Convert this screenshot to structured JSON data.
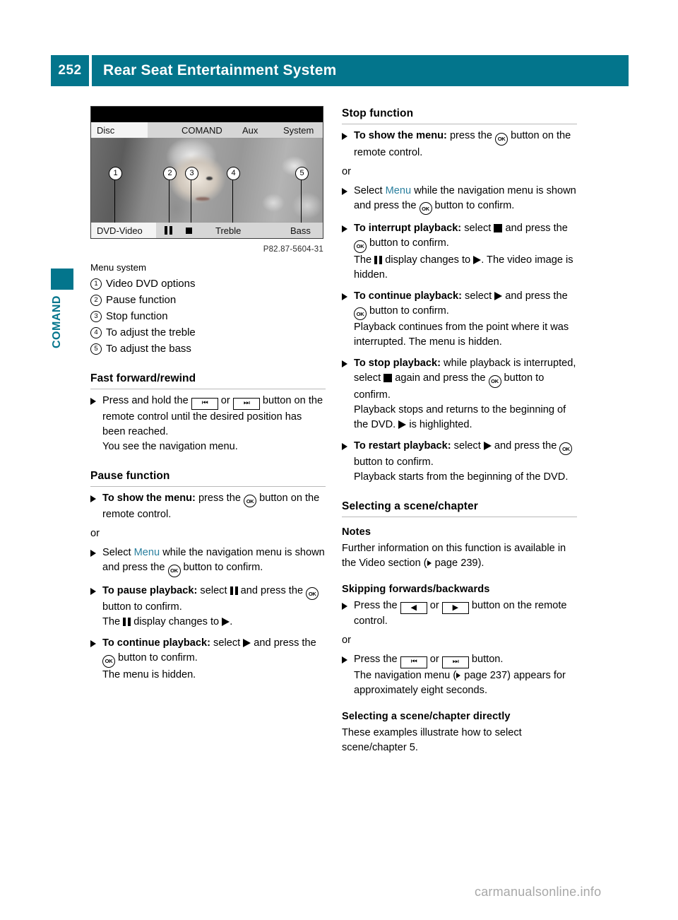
{
  "header": {
    "page_number": "252",
    "title": "Rear Seat Entertainment System"
  },
  "side_tab": {
    "label": "COMAND",
    "accent_color": "#03758c"
  },
  "figure": {
    "screen": {
      "top_tabs": [
        "Disc",
        "COMAND",
        "Aux",
        "System"
      ],
      "selected_top_tab": "Disc",
      "bottom_items": [
        "DVD-Video",
        "pause-glyph",
        "stop-glyph",
        "Treble",
        "Bass"
      ],
      "bottom_labels": {
        "source": "DVD-Video",
        "treble": "Treble",
        "bass": "Bass"
      },
      "callouts": [
        "1",
        "2",
        "3",
        "4",
        "5"
      ]
    },
    "caption": "P82.87-5604-31"
  },
  "legend": {
    "title": "Menu system",
    "items": [
      {
        "num": "1",
        "text": "Video DVD options"
      },
      {
        "num": "2",
        "text": "Pause function"
      },
      {
        "num": "3",
        "text": "Stop function"
      },
      {
        "num": "4",
        "text": "To adjust the treble"
      },
      {
        "num": "5",
        "text": "To adjust the bass"
      }
    ]
  },
  "left_column": {
    "fast_forward": {
      "heading": "Fast forward/rewind",
      "step1_a": "Press and hold the ",
      "step1_key1": "⏮",
      "step1_or": " or ",
      "step1_key2": "⏭",
      "step1_b": " button on the remote control until the desired position has been reached.",
      "step1_c": "You see the navigation menu."
    },
    "pause_function": {
      "heading": "Pause function",
      "s1_bold": "To show the menu:",
      "s1_a": " press the ",
      "s1_ok": "OK",
      "s1_b": " button on the remote control.",
      "or": "or",
      "s2_a": "Select ",
      "s2_menu": "Menu",
      "s2_b": " while the navigation menu is shown and press the ",
      "s2_ok": "OK",
      "s2_c": " button to confirm.",
      "s3_bold": "To pause playback:",
      "s3_a": " select ",
      "s3_b": " and press the ",
      "s3_ok": "OK",
      "s3_c": " button to confirm.",
      "s3_d1": "The ",
      "s3_d2": " display changes to ",
      "s3_d3": ".",
      "s4_bold": "To continue playback:",
      "s4_a": " select ",
      "s4_b": " and press the ",
      "s4_ok": "OK",
      "s4_c": " button to confirm.",
      "s4_d": "The menu is hidden."
    }
  },
  "right_column": {
    "stop_function": {
      "heading": "Stop function",
      "s1_bold": "To show the menu:",
      "s1_a": " press the ",
      "s1_ok": "OK",
      "s1_b": " button on the remote control.",
      "or": "or",
      "s2_a": "Select ",
      "s2_menu": "Menu",
      "s2_b": " while the navigation menu is shown and press the ",
      "s2_ok": "OK",
      "s2_c": " button to confirm.",
      "s3_bold": "To interrupt playback:",
      "s3_a": " select ",
      "s3_b": " and press the ",
      "s3_ok": "OK",
      "s3_c": " button to confirm.",
      "s3_d1": "The ",
      "s3_d2": " display changes to ",
      "s3_d3": ". The video image is hidden.",
      "s4_bold": "To continue playback:",
      "s4_a": " select ",
      "s4_b": " and press the ",
      "s4_ok": "OK",
      "s4_c": " button to confirm.",
      "s4_d": "Playback continues from the point where it was interrupted. The menu is hidden.",
      "s5_bold": "To stop playback:",
      "s5_a": " while playback is interrupted, select ",
      "s5_b": " again and press the ",
      "s5_ok": "OK",
      "s5_c": " button to confirm.",
      "s5_d1": "Playback stops and returns to the beginning of the DVD. ",
      "s5_d2": " is highlighted.",
      "s6_bold": "To restart playback:",
      "s6_a": " select ",
      "s6_b": " and press the ",
      "s6_ok": "OK",
      "s6_c": " button to confirm.",
      "s6_d": "Playback starts from the beginning of the DVD."
    },
    "selecting_scene": {
      "heading": "Selecting a scene/chapter",
      "notes_heading": "Notes",
      "notes_a": "Further information on this function is available in the Video section (",
      "notes_ref": " page 239",
      "notes_b": ").",
      "skipping_heading": "Skipping forwards/backwards",
      "sk1_a": "Press the ",
      "sk1_key1": "◀",
      "sk1_or": " or ",
      "sk1_key2": "▶",
      "sk1_b": " button on the remote control.",
      "or": "or",
      "sk2_a": "Press the ",
      "sk2_key1": "⏮",
      "sk2_or": " or ",
      "sk2_key2": "⏭",
      "sk2_b": " button.",
      "sk2_c1": "The navigation menu (",
      "sk2_ref": " page 237",
      "sk2_c2": ") appears for approximately eight seconds.",
      "directly_heading": "Selecting a scene/chapter directly",
      "directly_text": "These examples illustrate how to select scene/chapter 5."
    }
  },
  "watermark": "carmanualsonline.info"
}
